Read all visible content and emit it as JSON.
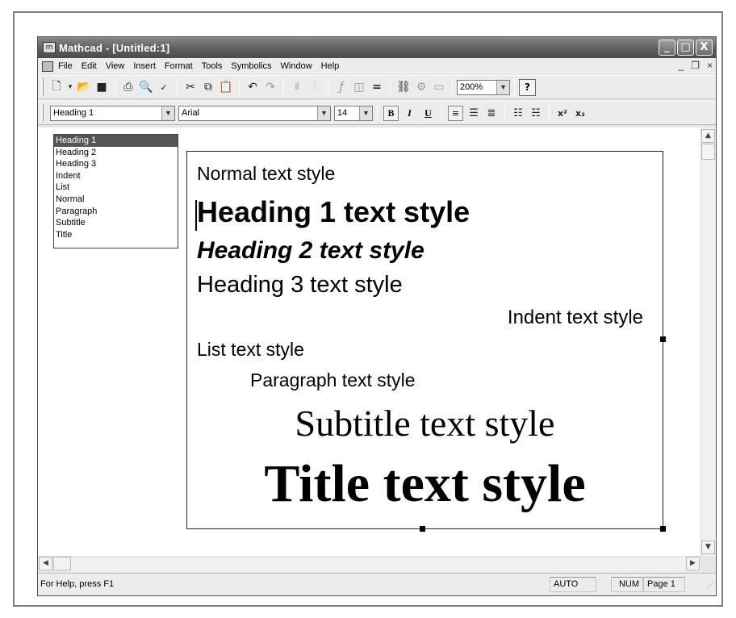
{
  "window": {
    "app_icon": "m",
    "title": "Mathcad - [Untitled:1]",
    "buttons": {
      "minimize": "_",
      "maximize": "□",
      "close": "X"
    }
  },
  "menubar": {
    "items": [
      "File",
      "Edit",
      "View",
      "Insert",
      "Format",
      "Tools",
      "Symbolics",
      "Window",
      "Help"
    ],
    "mdi": {
      "minimize": "_",
      "restore": "❐",
      "close": "×"
    }
  },
  "toolbar": {
    "zoom_value": "200%",
    "help_label": "?"
  },
  "format_bar": {
    "style_value": "Heading 1",
    "font_value": "Arial",
    "size_value": "14",
    "bold_label": "B",
    "italic_label": "I",
    "underline_label": "U",
    "superscript_label": "x²",
    "subscript_label": "x₂"
  },
  "style_dropdown": {
    "options": [
      "Heading 1",
      "Heading 2",
      "Heading 3",
      "Indent",
      "List",
      "Normal",
      "Paragraph",
      "Subtitle",
      "Title"
    ],
    "selected": "Heading 1"
  },
  "document": {
    "lines": {
      "normal": "Normal text style",
      "heading1": "Heading 1 text style",
      "heading2": "Heading 2 text style",
      "heading3": "Heading 3 text style",
      "indent": "Indent text style",
      "list": "List text style",
      "paragraph": "Paragraph text style",
      "subtitle": "Subtitle text style",
      "title": "Title text style"
    }
  },
  "statusbar": {
    "help": "For Help, press F1",
    "mode": "AUTO",
    "num": "NUM",
    "page": "Page 1"
  },
  "colors": {
    "titlebar": "#5e5e5e",
    "dropdown_selected": "#555555",
    "workspace": "#ffffff"
  }
}
